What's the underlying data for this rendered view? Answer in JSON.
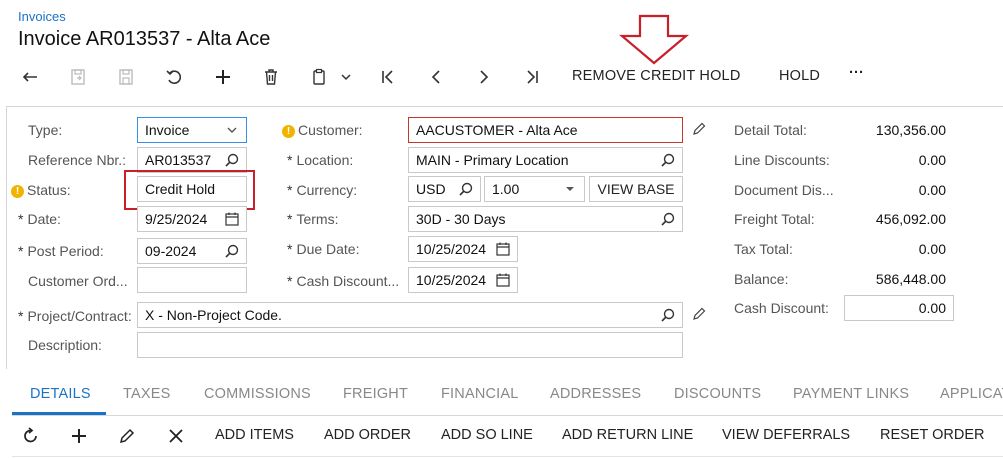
{
  "breadcrumb": "Invoices",
  "title": "Invoice AR013537 - Alta Ace",
  "toolbar": {
    "icons": [
      "back-icon",
      "save-close-icon",
      "save-icon",
      "undo-icon",
      "add-icon",
      "delete-icon",
      "copy-paste-icon",
      "first-record-icon",
      "previous-record-icon",
      "next-record-icon",
      "last-record-icon"
    ],
    "remove_credit_hold": "REMOVE CREDIT HOLD",
    "hold": "HOLD",
    "more": "···"
  },
  "form": {
    "type_label": "Type:",
    "type_value": "Invoice",
    "ref_label": "Reference Nbr.:",
    "ref_value": "AR013537",
    "status_label": "Status:",
    "status_value": "Credit Hold",
    "date_label": "Date:",
    "date_value": "9/25/2024",
    "post_period_label": "Post Period:",
    "post_period_value": "09-2024",
    "customer_order_label": "Customer Ord...",
    "customer_order_value": "",
    "project_label": "Project/Contract:",
    "project_value": "X - Non-Project Code.",
    "description_label": "Description:",
    "description_value": "",
    "customer_label": "Customer:",
    "customer_value": "AACUSTOMER - Alta Ace",
    "location_label": "Location:",
    "location_value": "MAIN - Primary Location",
    "currency_label": "Currency:",
    "currency_value": "USD",
    "rate_value": "1.00",
    "view_base": "VIEW BASE",
    "terms_label": "Terms:",
    "terms_value": "30D - 30 Days",
    "due_date_label": "Due Date:",
    "due_date_value": "10/25/2024",
    "cash_discount_date_label": "Cash Discount...",
    "cash_discount_date_value": "10/25/2024",
    "required_mark": "*",
    "warning_mark": "!"
  },
  "summary": {
    "detail_total_label": "Detail Total:",
    "detail_total_value": "130,356.00",
    "line_discounts_label": "Line Discounts:",
    "line_discounts_value": "0.00",
    "document_discount_label": "Document Dis...",
    "document_discount_value": "0.00",
    "freight_total_label": "Freight Total:",
    "freight_total_value": "456,092.00",
    "tax_total_label": "Tax Total:",
    "tax_total_value": "0.00",
    "balance_label": "Balance:",
    "balance_value": "586,448.00",
    "cash_discount_label": "Cash Discount:",
    "cash_discount_value": "0.00"
  },
  "tabs": [
    "DETAILS",
    "TAXES",
    "COMMISSIONS",
    "FREIGHT",
    "FINANCIAL",
    "ADDRESSES",
    "DISCOUNTS",
    "PAYMENT LINKS",
    "APPLICAT"
  ],
  "grid_toolbar": {
    "icons": [
      "refresh-icon",
      "add-row-icon",
      "edit-icon",
      "delete-row-icon"
    ],
    "add_items": "ADD ITEMS",
    "add_order": "ADD ORDER",
    "add_so_line": "ADD SO LINE",
    "add_return_line": "ADD RETURN LINE",
    "view_deferrals": "VIEW DEFERRALS",
    "reset_order": "RESET ORDER"
  },
  "colors": {
    "accent": "#1a73c8",
    "annotation": "#c8202a",
    "warning": "#f0b400"
  }
}
